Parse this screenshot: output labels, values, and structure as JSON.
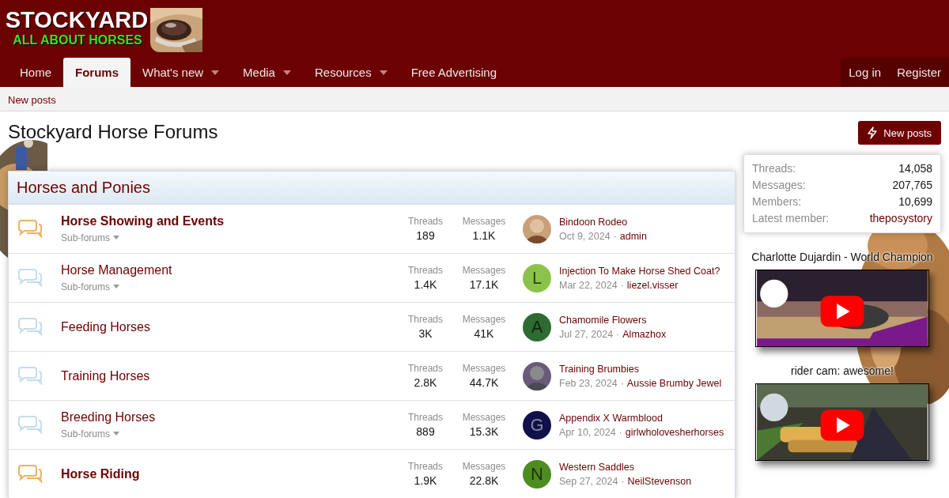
{
  "logo": {
    "title": "STOCKYARD",
    "tagline": "ALL ABOUT HORSES"
  },
  "nav": {
    "items": [
      {
        "label": "Home",
        "selected": false,
        "dropdown": false
      },
      {
        "label": "Forums",
        "selected": true,
        "dropdown": false
      },
      {
        "label": "What's new",
        "selected": false,
        "dropdown": true
      },
      {
        "label": "Media",
        "selected": false,
        "dropdown": true
      },
      {
        "label": "Resources",
        "selected": false,
        "dropdown": true
      },
      {
        "label": "Free Advertising",
        "selected": false,
        "dropdown": false
      }
    ],
    "account": [
      "Log in",
      "Register"
    ]
  },
  "subnav": [
    "New posts"
  ],
  "page_title": "Stockyard Horse Forums",
  "new_posts_button": "New posts",
  "category": {
    "title": "Horses and Ponies",
    "forums": [
      {
        "title": "Horse Showing and Events",
        "unread": true,
        "subforums": "Sub-forums",
        "threads_label": "Threads",
        "threads": "189",
        "messages_label": "Messages",
        "messages": "1.1K",
        "last_thread": "Bindoon Rodeo",
        "last_date": "Oct 9, 2024",
        "separator": "·",
        "last_user": "admin"
      },
      {
        "title": "Horse Management",
        "unread": false,
        "subforums": "Sub-forums",
        "threads_label": "Threads",
        "threads": "1.4K",
        "messages_label": "Messages",
        "messages": "17.1K",
        "avatar": {
          "kind": "letter",
          "letter": "L",
          "color": "#8bc34a"
        },
        "last_thread": "Injection To Make Horse Shed Coat?",
        "last_date": "Mar 22, 2024",
        "separator": "·",
        "last_user": "liezel.visser"
      },
      {
        "title": "Feeding Horses",
        "unread": false,
        "threads_label": "Threads",
        "threads": "3K",
        "messages_label": "Messages",
        "messages": "41K",
        "avatar": {
          "kind": "letter",
          "letter": "A",
          "color": "#2e6b30"
        },
        "last_thread": "Chamomile Flowers",
        "last_date": "Jul 27, 2024",
        "separator": "·",
        "last_user": "Almazhox"
      },
      {
        "title": "Training Horses",
        "unread": false,
        "threads_label": "Threads",
        "threads": "2.8K",
        "messages_label": "Messages",
        "messages": "44.7K",
        "last_thread": "Training Brumbies",
        "last_date": "Feb 23, 2024",
        "separator": "·",
        "last_user": "Aussie Brumby Jewel"
      },
      {
        "title": "Breeding Horses",
        "unread": false,
        "subforums": "Sub-forums",
        "threads_label": "Threads",
        "threads": "889",
        "messages_label": "Messages",
        "messages": "15.3K",
        "avatar": {
          "kind": "letter",
          "letter": "G",
          "color": "#10104a"
        },
        "last_thread": "Appendix X Warmblood",
        "last_date": "Apr 10, 2024",
        "separator": "·",
        "last_user": "girlwholovesherhorses"
      },
      {
        "title": "Horse Riding",
        "unread": true,
        "threads_label": "Threads",
        "threads": "1.9K",
        "messages_label": "Messages",
        "messages": "22.8K",
        "avatar": {
          "kind": "letter",
          "letter": "N",
          "color": "#4d8c1f"
        },
        "last_thread": "Western Saddles",
        "last_date": "Sep 27, 2024",
        "separator": "·",
        "last_user": "NeilStevenson"
      }
    ]
  },
  "stats": [
    {
      "label": "Threads:",
      "value": "14,058",
      "kind": "plain"
    },
    {
      "label": "Messages:",
      "value": "207,765",
      "kind": "plain"
    },
    {
      "label": "Members:",
      "value": "10,699",
      "kind": "plain"
    },
    {
      "label": "Latest member:",
      "value": "theposystory",
      "kind": "link"
    }
  ],
  "videos": [
    {
      "caption": "Charlotte Dujardin - World Champion",
      "kind": "picture"
    },
    {
      "caption": "rider cam: awesome!",
      "kind": "picture"
    }
  ]
}
